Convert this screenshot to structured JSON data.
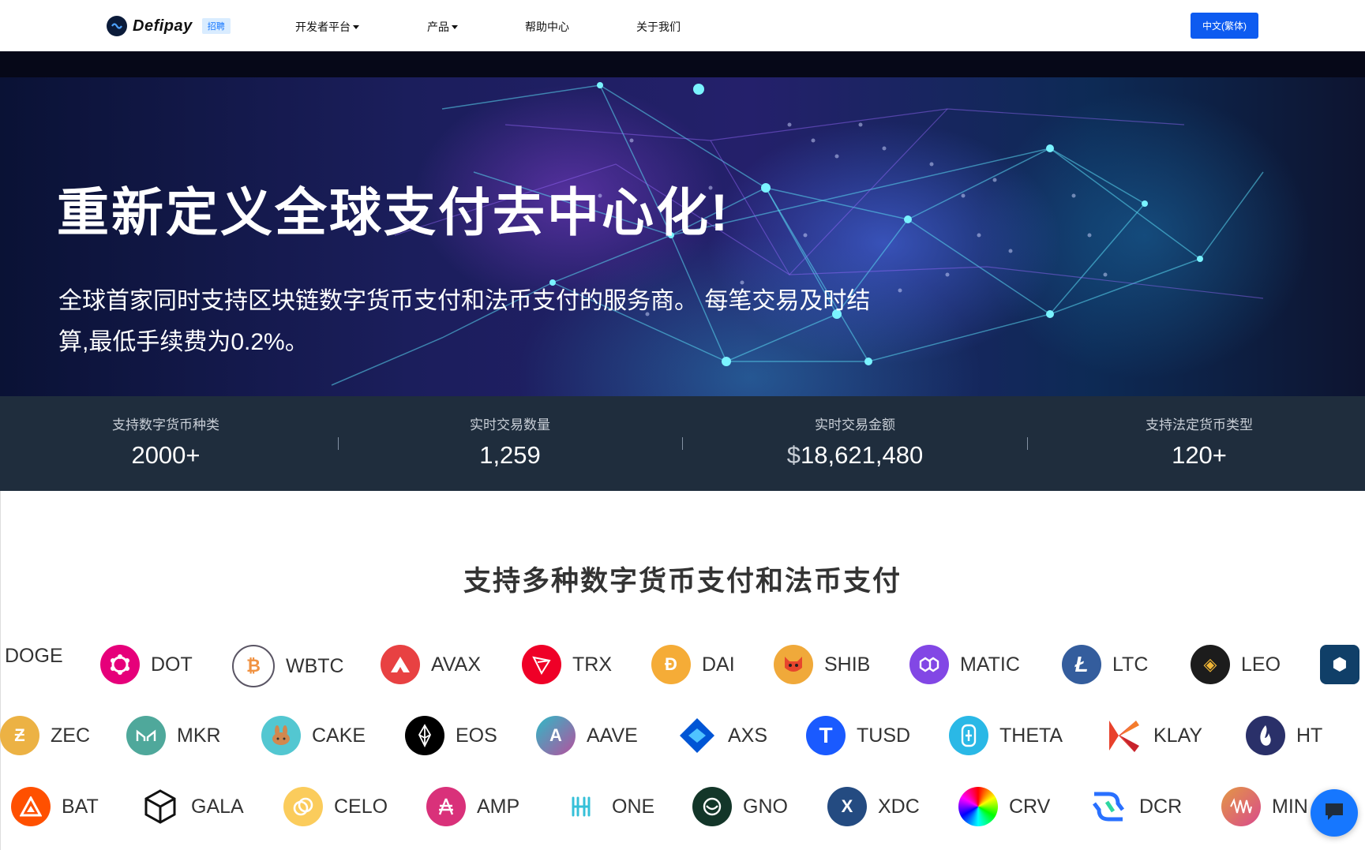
{
  "nav": {
    "logo_text": "Defipay",
    "badge": "招聘",
    "items": [
      {
        "label": "开发者平台",
        "dropdown": true
      },
      {
        "label": "产品",
        "dropdown": true
      },
      {
        "label": "帮助中心",
        "dropdown": false
      },
      {
        "label": "关于我们",
        "dropdown": false
      }
    ],
    "lang_button": "中文(繁体)"
  },
  "hero": {
    "title": "重新定义全球支付去中心化!",
    "subtitle": "全球首家同时支持区块链数字货币支付和法币支付的服务商。 每笔交易及时结算,最低手续费为0.2%。"
  },
  "stats": [
    {
      "label": "支持数字货币种类",
      "value": "2000+"
    },
    {
      "label": "实时交易数量",
      "value": "1,259"
    },
    {
      "label": "实时交易金额",
      "currency": "$",
      "value": "18,621,480"
    },
    {
      "label": "支持法定货币类型",
      "value": "120+"
    }
  ],
  "coins_section": {
    "title": "支持多种数字货币支付和法币支付",
    "rows": [
      [
        {
          "label": "DOGE",
          "icon": "doge-icon",
          "color": "#c2a633"
        },
        {
          "label": "DOT",
          "icon": "dot-icon",
          "color": "#e6007a"
        },
        {
          "label": "WBTC",
          "icon": "wbtc-icon",
          "color": "#f09242"
        },
        {
          "label": "AVAX",
          "icon": "avax-icon",
          "color": "#e84142"
        },
        {
          "label": "TRX",
          "icon": "trx-icon",
          "color": "#ef0027"
        },
        {
          "label": "DAI",
          "icon": "dai-icon",
          "color": "#f5ac37"
        },
        {
          "label": "SHIB",
          "icon": "shib-icon",
          "color": "#f0a93a"
        },
        {
          "label": "MATIC",
          "icon": "matic-icon",
          "color": "#8247e5"
        },
        {
          "label": "LTC",
          "icon": "ltc-icon",
          "color": "#345d9d"
        },
        {
          "label": "LEO",
          "icon": "leo-icon",
          "color": "#1c1c1c"
        },
        {
          "label": "",
          "icon": "cro-icon",
          "color": "#103f68"
        }
      ],
      [
        {
          "label": "ZEC",
          "icon": "zec-icon",
          "color": "#ecb244"
        },
        {
          "label": "MKR",
          "icon": "mkr-icon",
          "color": "#4fa89b"
        },
        {
          "label": "CAKE",
          "icon": "cake-icon",
          "color": "#53c7d1"
        },
        {
          "label": "EOS",
          "icon": "eos-icon",
          "color": "#000000"
        },
        {
          "label": "AAVE",
          "icon": "aave-icon",
          "color": "#7b6aa6"
        },
        {
          "label": "AXS",
          "icon": "axs-icon",
          "color": "#0055d5"
        },
        {
          "label": "TUSD",
          "icon": "tusd-icon",
          "color": "#1a5aff"
        },
        {
          "label": "THETA",
          "icon": "theta-icon",
          "color": "#2ab8e6"
        },
        {
          "label": "KLAY",
          "icon": "klay-icon",
          "color": "#e8412c"
        },
        {
          "label": "HT",
          "icon": "ht-icon",
          "color": "#2a3069"
        }
      ],
      [
        {
          "label": "BAT",
          "icon": "bat-icon",
          "color": "#ff5000"
        },
        {
          "label": "GALA",
          "icon": "gala-icon",
          "color": "#ffffff"
        },
        {
          "label": "CELO",
          "icon": "celo-icon",
          "color": "#fbcc5c"
        },
        {
          "label": "AMP",
          "icon": "amp-icon",
          "color": "#d9317a"
        },
        {
          "label": "ONE",
          "icon": "one-icon",
          "color": "#ffffff"
        },
        {
          "label": "GNO",
          "icon": "gno-icon",
          "color": "#133629"
        },
        {
          "label": "XDC",
          "icon": "xdc-icon",
          "color": "#244b81"
        },
        {
          "label": "CRV",
          "icon": "crv-icon",
          "color": "#ffffff"
        },
        {
          "label": "DCR",
          "icon": "dcr-icon",
          "color": "#ffffff"
        },
        {
          "label": "MIN",
          "icon": "mina-icon",
          "color": "#e39844"
        }
      ]
    ]
  },
  "chat": {
    "icon": "chat-icon"
  }
}
